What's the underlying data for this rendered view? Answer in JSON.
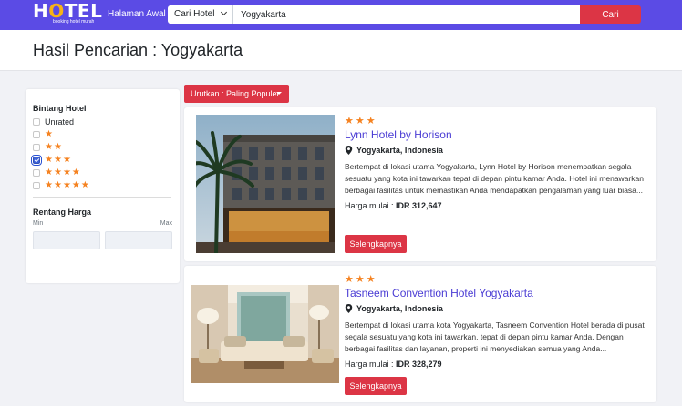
{
  "header": {
    "logo_text_h": "H",
    "logo_text_o": "O",
    "logo_text_rest": "TEL",
    "logo_sub": "booking hotel murah",
    "nav_home": "Halaman Awal",
    "search_type": "Cari Hotel",
    "search_value": "Yogyakarta",
    "search_button": "Cari"
  },
  "page": {
    "title": "Hasil Pencarian : Yogyakarta",
    "sort_label": "Urutkan : Paling Populer"
  },
  "filters": {
    "star_title": "Bintang Hotel",
    "unrated_label": "Unrated",
    "star_options": [
      {
        "stars": 1,
        "checked": false
      },
      {
        "stars": 2,
        "checked": false
      },
      {
        "stars": 3,
        "checked": true
      },
      {
        "stars": 4,
        "checked": false
      },
      {
        "stars": 5,
        "checked": false
      }
    ],
    "price_title": "Rentang Harga",
    "min_label": "Min",
    "max_label": "Max"
  },
  "hotels": [
    {
      "stars": 3,
      "name": "Lynn Hotel by Horison",
      "location": "Yogyakarta, Indonesia",
      "description": "Bertempat di lokasi utama Yogyakarta, Lynn Hotel by Horison menempatkan segala sesuatu yang kota ini tawarkan tepat di depan pintu kamar Anda. Hotel ini menawarkan berbagai fasilitas untuk memastikan Anda mendapatkan pengalaman yang luar biasa...",
      "price_label": "Harga mulai : ",
      "price_value": "IDR 312,647",
      "button": "Selengkapnya"
    },
    {
      "stars": 3,
      "name": "Tasneem Convention Hotel Yogyakarta",
      "location": "Yogyakarta, Indonesia",
      "description": "Bertempat di lokasi utama kota Yogyakarta, Tasneem Convention Hotel berada di pusat segala sesuatu yang kota ini tawarkan, tepat di depan pintu kamar Anda. Dengan berbagai fasilitas dan layanan, properti ini menyediakan semua yang Anda...",
      "price_label": "Harga mulai : ",
      "price_value": "IDR 328,279",
      "button": "Selengkapnya"
    }
  ],
  "colors": {
    "header": "#5b4be5",
    "accent_red": "#dc3545",
    "star": "#f58220",
    "hotel_name": "#4a3cd4"
  },
  "icons": {
    "star": "star-icon",
    "location": "map-pin-icon",
    "select_caret": "chevron-down-icon",
    "sort_caret": "caret-down-icon"
  }
}
